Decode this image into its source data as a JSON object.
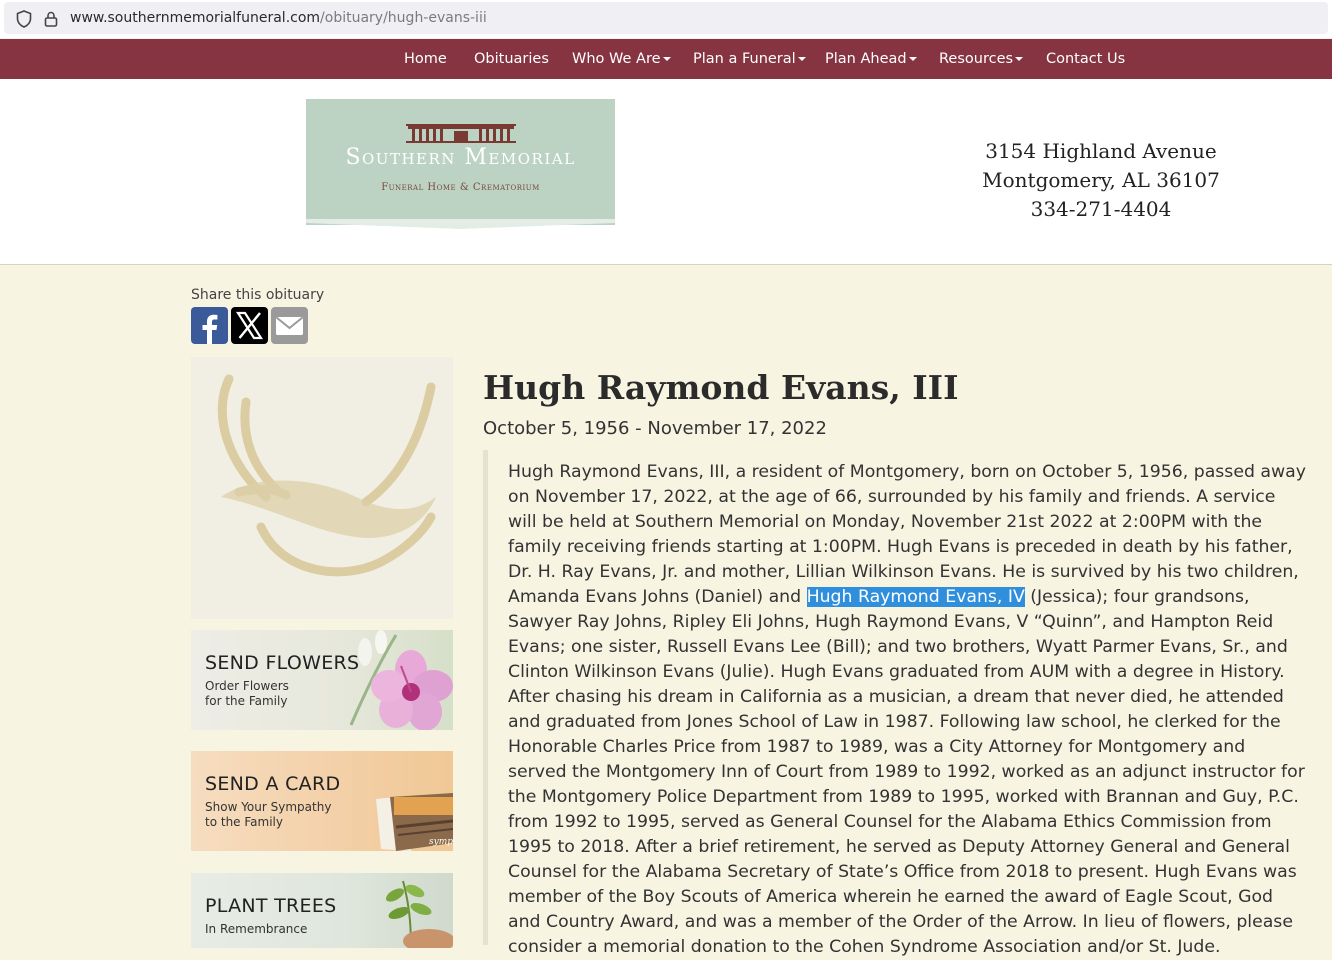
{
  "browser": {
    "url_host": "www.southernmemorialfuneral.com",
    "url_path": "/obituary/hugh-evans-iii"
  },
  "nav": {
    "items": [
      {
        "label": "Home"
      },
      {
        "label": "Obituaries"
      },
      {
        "label": "Who We Are"
      },
      {
        "label": "Plan a Funeral"
      },
      {
        "label": "Plan Ahead"
      },
      {
        "label": "Resources"
      },
      {
        "label": "Contact Us"
      }
    ]
  },
  "logo": {
    "name": "Southern Memorial",
    "subtitle": "Funeral Home & Crematorium"
  },
  "address": {
    "street": "3154 Highland Avenue",
    "city": "Montgomery, AL 36107",
    "phone": "334-271-4404"
  },
  "share": {
    "label": "Share this obituary",
    "icons": [
      "facebook-icon",
      "x-icon",
      "email-icon"
    ]
  },
  "tiles": {
    "flowers": {
      "title": "SEND FLOWERS",
      "sub1": "Order Flowers",
      "sub2": "for the Family"
    },
    "card": {
      "title": "SEND A CARD",
      "sub1": "Show Your Sympathy",
      "sub2": "to the Family",
      "card_caption": "sympathy"
    },
    "trees": {
      "title": "PLANT TREES",
      "sub1": "In Remembrance"
    }
  },
  "obituary": {
    "name": "Hugh Raymond Evans, III",
    "dates": "October 5, 1956 - November 17, 2022",
    "text_before": "Hugh Raymond Evans, III, a resident of Montgomery, born on October 5, 1956, passed away on November 17, 2022, at the age of 66, surrounded by his family and friends. A service will be held at Southern Memorial on Monday, November 21st 2022 at 2:00PM with the family receiving friends starting at 1:00PM. Hugh Evans is preceded in death by his father, Dr. H. Ray Evans, Jr. and mother, Lillian Wilkinson Evans. He is survived by his two children, Amanda Evans Johns (Daniel) and ",
    "text_highlight": "Hugh Raymond Evans, IV",
    "text_after": " (Jessica); four grandsons, Sawyer Ray Johns, Ripley Eli Johns, Hugh Raymond Evans, V “Quinn”, and Hampton Reid Evans; one sister, Russell Evans Lee (Bill); and two brothers, Wyatt Parmer Evans, Sr., and Clinton Wilkinson Evans (Julie). Hugh Evans graduated from AUM with a degree in History. After chasing his dream in California as a musician, a dream that never died, he attended and graduated from Jones School of Law in 1987. Following law school, he clerked for the Honorable Charles Price from 1987 to 1989, was a City Attorney for Montgomery and served the Montgomery Inn of Court from 1989 to 1992, worked as an adjunct instructor for the Montgomery Police Department from 1989 to 1995, worked with Brannan and Guy, P.C. from 1992 to 1995, served as General Counsel for the Alabama Ethics Commission from 1995 to 2018. After a brief retirement, he served as Deputy Attorney General and General Counsel for the Alabama Secretary of State’s Office from 2018 to present. Hugh Evans was member of the Boy Scouts of America wherein he earned the award of Eagle Scout, God and Country Award, and was a member of the Order of the Arrow. In lieu of flowers, please consider a memorial donation to the Cohen Syndrome Association and/or St. Jude."
  },
  "colors": {
    "nav_bg": "#863442",
    "page_bg": "#f7f4e2",
    "logo_bg": "#bcd2c2",
    "selection": "#2f8fdc"
  }
}
